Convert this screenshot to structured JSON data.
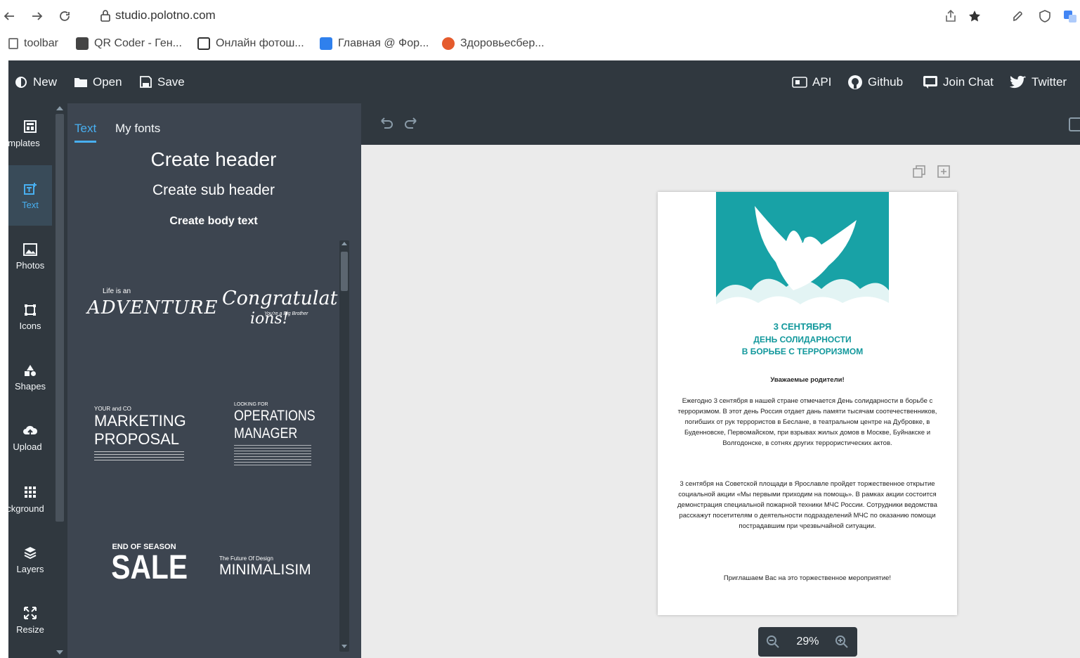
{
  "browser": {
    "url": "studio.polotno.com",
    "bookmarks": [
      {
        "label": "toolbar",
        "icon": "page-icon",
        "color": "#666666"
      },
      {
        "label": "QR Coder - Ген...",
        "icon": "qr-icon",
        "color": "#444444"
      },
      {
        "label": "Онлайн фотош...",
        "icon": "photo-editor-icon",
        "color": "#333333"
      },
      {
        "label": "Главная @ Фор...",
        "icon": "forum-icon",
        "color": "#2f80ed"
      },
      {
        "label": "Здоровьесбер...",
        "icon": "apple-icon",
        "color": "#e55b2d"
      }
    ]
  },
  "topbar": {
    "new_label": "New",
    "open_label": "Open",
    "save_label": "Save",
    "api_label": "API",
    "github_label": "Github",
    "join_chat_label": "Join Chat",
    "twitter_label": "Twitter"
  },
  "side_tabs": [
    {
      "label": "mplates",
      "icon": "templates-icon",
      "active": false
    },
    {
      "label": "Text",
      "icon": "text-icon",
      "active": true
    },
    {
      "label": "Photos",
      "icon": "photos-icon",
      "active": false
    },
    {
      "label": "Icons",
      "icon": "icons-icon",
      "active": false
    },
    {
      "label": "Shapes",
      "icon": "shapes-icon",
      "active": false
    },
    {
      "label": "Upload",
      "icon": "upload-icon",
      "active": false
    },
    {
      "label": "ckground",
      "icon": "background-icon",
      "active": false
    },
    {
      "label": "Layers",
      "icon": "layers-icon",
      "active": false
    },
    {
      "label": "Resize",
      "icon": "resize-icon",
      "active": false
    }
  ],
  "text_panel": {
    "tab_text": "Text",
    "tab_my_fonts": "My fonts",
    "create_header": "Create header",
    "create_sub_header": "Create sub header",
    "create_body_text": "Create body text",
    "templates": {
      "adventure_small": "Life is an",
      "adventure_big": "ADVENTURE",
      "congrats_big": "Congratulat",
      "congrats_line2": "ions!",
      "congrats_small": "You're a Big Brother",
      "marketing_small": "YOUR and CO",
      "marketing_line1": "MARKETING",
      "marketing_line2": "PROPOSAL",
      "operations_small": "LOOKING FOR",
      "operations_line1": "OPERATIONS",
      "operations_line2": "MANAGER",
      "sale_small": "END OF SEASON",
      "sale_big": "SALE",
      "minimal_small": "The Future Of Design",
      "minimal_big": "MINIMALISIM"
    }
  },
  "document": {
    "banner_line1": "3 СЕНТЯБРЯ",
    "banner_line2": "ДЕНЬ СОЛИДАРНОСТИ",
    "banner_line3": "В БОРЬБЕ С ТЕРРОРИЗМОМ",
    "greeting": "Уважаемые родители!",
    "paragraph1": "Ежегодно 3 сентября в нашей стране отмечается День солидарности в борьбе с терроризмом. В этот день Россия отдает дань памяти тысячам соотечественников, погибших от рук террористов в Беслане, в театральном центре на Дубровке, в Буденновске, Первомайском, при взрывах жилых домов в Москве, Буйнакске и Волгодонске, в сотнях других террористических актов.",
    "paragraph2": "3 сентября на Советской площади в Ярославле пройдет торжественное открытие социальной акции «Мы первыми приходим на помощь». В рамках акции состоится демонстрация специальной пожарной техники МЧС России. Сотрудники ведомства расскажут посетителям о деятельности подразделений МЧС по оказанию помощи пострадавшим при чрезвычайной ситуации.",
    "closing": "Приглашаем Вас на это торжественное мероприятие!"
  },
  "zoom": {
    "level": "29%"
  },
  "colors": {
    "dark": "#30383f",
    "panel": "#3d4550",
    "accent": "#48aff0",
    "teal": "#18a2a6"
  }
}
